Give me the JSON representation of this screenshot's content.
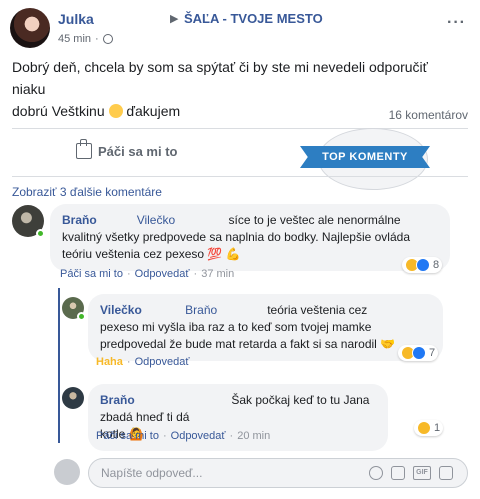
{
  "post": {
    "author": "Julka",
    "group": "ŠAĽA - TVOJE MESTO",
    "time": "45 min",
    "text_line1": "Dobrý deň, chcela by som sa spýtať či by ste mi nevedeli odporučiť niaku",
    "text_line2a": "dobrú Veštkinu",
    "text_line2b": "ďakujem",
    "comments_count": "16 komentárov",
    "like_label": "Páči sa mi to",
    "badge": "TOP KOMENTY",
    "view_more": "Zobraziť 3 ďalšie komentáre"
  },
  "comments": [
    {
      "name": "Braňo",
      "tag": "Vilečko",
      "text_a": "síce to je veštec ale nenormálne",
      "text_b": "kvalitný všetky predpovede sa naplnia do bodky. Najlepšie ovláda",
      "text_c": "teóriu veštenia cez pexeso 💯 💪",
      "like": "Páči sa mi to",
      "reply": "Odpovedať",
      "time": "37 min",
      "reactions": "8"
    },
    {
      "name": "Vilečko",
      "tag": "Braňo",
      "text_a": "teória veštenia cez",
      "text_b": "pexeso mi vyšla iba raz a to keď som tvojej mamke",
      "text_c": "predpovedal že bude mat retarda a fakt si sa narodil 🤝",
      "like": "Haha",
      "reply": "Odpovedať",
      "time": "",
      "reactions": "7"
    },
    {
      "name": "Braňo",
      "tag": "",
      "text_a": "Šak počkaj keď to tu Jana zbadá hneď ti dá",
      "text_b": "kotle 🙆",
      "text_c": "",
      "like": "Páči sa mi to",
      "reply": "Odpovedať",
      "time": "20 min",
      "reactions": "1"
    }
  ],
  "input": {
    "placeholder": "Napíšte odpoveď..."
  },
  "colors": {
    "link": "#385898",
    "badge": "#2d7ec2",
    "haha": "#f7b928"
  }
}
